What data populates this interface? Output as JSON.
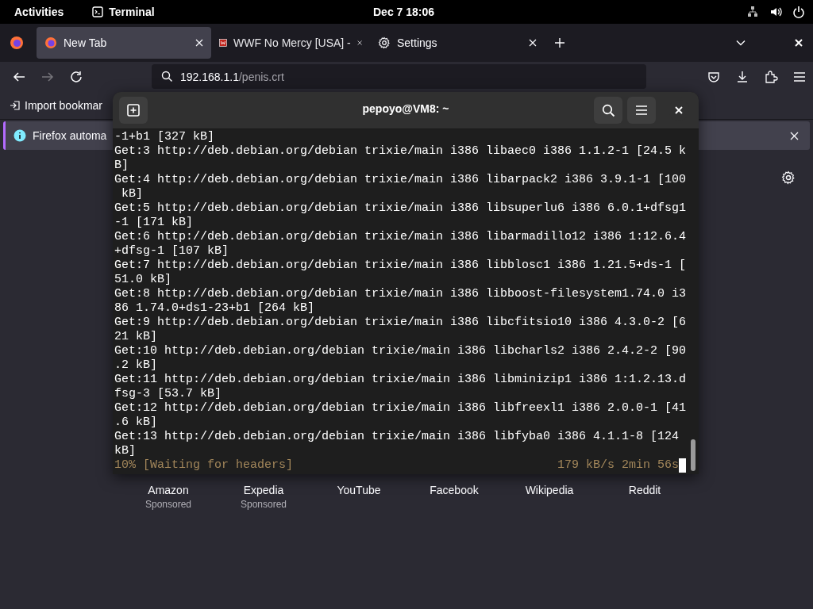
{
  "top_bar": {
    "activities": "Activities",
    "app": "Terminal",
    "clock": "Dec 7  18:06"
  },
  "browser": {
    "tabs": [
      {
        "label": "New Tab",
        "kind": "firefox",
        "selected": true
      },
      {
        "label": "WWF No Mercy [USA] -",
        "kind": "game",
        "selected": false
      },
      {
        "label": "Settings",
        "kind": "gear",
        "selected": false
      }
    ],
    "url": {
      "host": "192.168.1.1",
      "path": "/penis.crt"
    },
    "bookmarks_bar": {
      "import": "Import bookmar"
    },
    "notification": {
      "text": "Firefox automa"
    },
    "shortcuts": [
      {
        "title": "Amazon",
        "note": "Sponsored"
      },
      {
        "title": "Expedia",
        "note": "Sponsored"
      },
      {
        "title": "YouTube"
      },
      {
        "title": "Facebook"
      },
      {
        "title": "Wikipedia"
      },
      {
        "title": "Reddit"
      }
    ]
  },
  "terminal": {
    "title": "pepoyo@VM8: ~",
    "lines": [
      "-1+b1 [327 kB]",
      "Get:3 http://deb.debian.org/debian trixie/main i386 libaec0 i386 1.1.2-1 [24.5 k",
      "B]",
      "Get:4 http://deb.debian.org/debian trixie/main i386 libarpack2 i386 3.9.1-1 [100",
      " kB]",
      "Get:5 http://deb.debian.org/debian trixie/main i386 libsuperlu6 i386 6.0.1+dfsg1",
      "-1 [171 kB]",
      "Get:6 http://deb.debian.org/debian trixie/main i386 libarmadillo12 i386 1:12.6.4",
      "+dfsg-1 [107 kB]",
      "Get:7 http://deb.debian.org/debian trixie/main i386 libblosc1 i386 1.21.5+ds-1 [",
      "51.0 kB]",
      "Get:8 http://deb.debian.org/debian trixie/main i386 libboost-filesystem1.74.0 i3",
      "86 1.74.0+ds1-23+b1 [264 kB]",
      "Get:9 http://deb.debian.org/debian trixie/main i386 libcfitsio10 i386 4.3.0-2 [6",
      "21 kB]",
      "Get:10 http://deb.debian.org/debian trixie/main i386 libcharls2 i386 2.4.2-2 [90",
      ".2 kB]",
      "Get:11 http://deb.debian.org/debian trixie/main i386 libminizip1 i386 1:1.2.13.d",
      "fsg-3 [53.7 kB]",
      "Get:12 http://deb.debian.org/debian trixie/main i386 libfreexl1 i386 2.0.0-1 [41",
      ".6 kB]",
      "Get:13 http://deb.debian.org/debian trixie/main i386 libfyba0 i386 4.1.1-8 [124",
      "kB]"
    ],
    "status_left": "10% [Waiting for headers]",
    "status_right": "179 kB/s 2min 56s"
  }
}
